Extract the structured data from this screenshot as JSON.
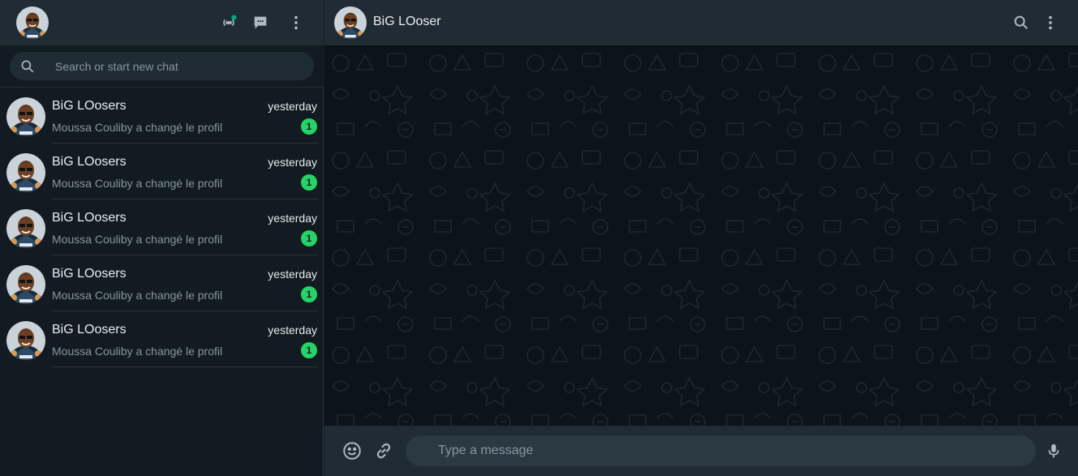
{
  "colors": {
    "header_bg": "#202c33",
    "panel_bg": "#111b21",
    "conversation_bg": "#0b141a",
    "unread_badge": "#25d366",
    "status_dot": "#00a884",
    "muted_text": "#8696a0"
  },
  "sidebar": {
    "header_icons": [
      "avatar",
      "status-icon",
      "new-chat-icon",
      "menu-icon"
    ],
    "search": {
      "placeholder": "Search or start new chat",
      "value": ""
    },
    "chats": [
      {
        "name": "BiG LOosers",
        "time": "yesterday",
        "preview": "Moussa Couliby a changé le profil",
        "unread": "1"
      },
      {
        "name": "BiG LOosers",
        "time": "yesterday",
        "preview": "Moussa Couliby a changé le profil",
        "unread": "1"
      },
      {
        "name": "BiG LOosers",
        "time": "yesterday",
        "preview": "Moussa Couliby a changé le profil",
        "unread": "1"
      },
      {
        "name": "BiG LOosers",
        "time": "yesterday",
        "preview": "Moussa Couliby a changé le profil",
        "unread": "1"
      },
      {
        "name": "BiG LOosers",
        "time": "yesterday",
        "preview": "Moussa Couliby a changé le profil",
        "unread": "1"
      }
    ]
  },
  "main": {
    "title": "BiG LOoser",
    "header_icons": [
      "search-icon",
      "menu-icon"
    ],
    "composer": {
      "placeholder": "Type a message",
      "value": "",
      "icons": [
        "emoji-icon",
        "attach-link-icon",
        "microphone-icon"
      ]
    }
  }
}
